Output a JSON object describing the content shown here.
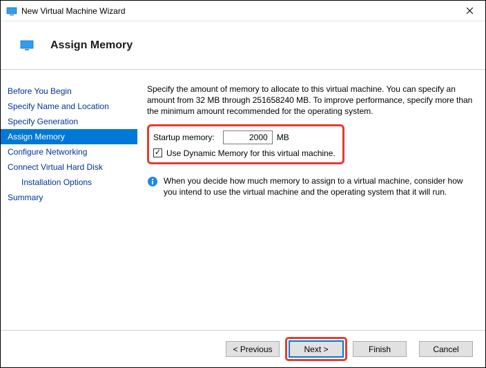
{
  "window": {
    "title": "New Virtual Machine Wizard"
  },
  "header": {
    "title": "Assign Memory"
  },
  "sidebar": {
    "items": [
      {
        "label": "Before You Begin"
      },
      {
        "label": "Specify Name and Location"
      },
      {
        "label": "Specify Generation"
      },
      {
        "label": "Assign Memory"
      },
      {
        "label": "Configure Networking"
      },
      {
        "label": "Connect Virtual Hard Disk"
      },
      {
        "label": "Installation Options"
      },
      {
        "label": "Summary"
      }
    ]
  },
  "main": {
    "description": "Specify the amount of memory to allocate to this virtual machine. You can specify an amount from 32 MB through 251658240 MB. To improve performance, specify more than the minimum amount recommended for the operating system.",
    "startup_label": "Startup memory:",
    "startup_value": "2000",
    "startup_unit": "MB",
    "dynamic_checkbox_label": "Use Dynamic Memory for this virtual machine.",
    "dynamic_checked": true,
    "info_text": "When you decide how much memory to assign to a virtual machine, consider how you intend to use the virtual machine and the operating system that it will run."
  },
  "footer": {
    "previous": "< Previous",
    "next": "Next >",
    "finish": "Finish",
    "cancel": "Cancel"
  },
  "annotations": {
    "highlight_color": "#e43c2f"
  }
}
